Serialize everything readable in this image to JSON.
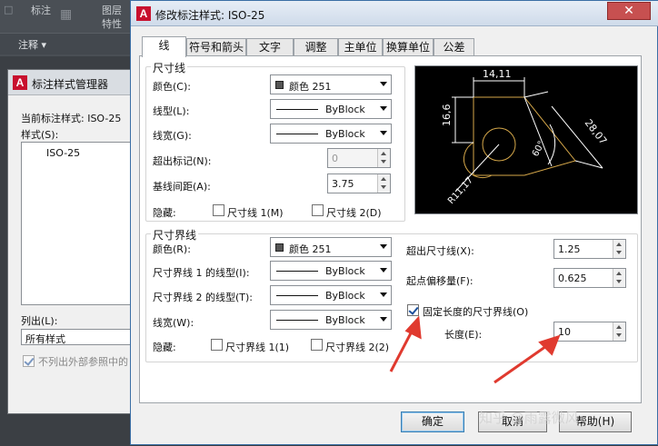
{
  "ribbon": {
    "tab_mark": "标注",
    "layer_label": "图层",
    "props_label": "特性",
    "annotate_label": "注释 ▾"
  },
  "manager": {
    "title": "标注样式管理器",
    "current_style": "当前标注样式: ISO-25",
    "styles_label": "样式(S):",
    "style_item": "ISO-25",
    "list_label": "列出(L):",
    "list_value": "所有样式",
    "xref_checkbox": "不列出外部参照中的"
  },
  "dialog": {
    "title": "修改标注样式: ISO-25",
    "close_symbol": "✕",
    "tabs": [
      "线",
      "符号和箭头",
      "文字",
      "调整",
      "主单位",
      "换算单位",
      "公差"
    ],
    "active_tab": 0,
    "dimline": {
      "group_title": "尺寸线",
      "color_label": "颜色(C):",
      "color_value": "颜色 251",
      "linetype_label": "线型(L):",
      "linetype_value": "ByBlock",
      "lineweight_label": "线宽(G):",
      "lineweight_value": "ByBlock",
      "extend_label": "超出标记(N):",
      "extend_value": "0",
      "baseline_label": "基线间距(A):",
      "baseline_value": "3.75",
      "suppress_label": "隐藏:",
      "suppress_1": "尺寸线 1(M)",
      "suppress_2": "尺寸线 2(D)"
    },
    "extline": {
      "group_title": "尺寸界线",
      "color_label": "颜色(R):",
      "color_value": "颜色 251",
      "linetype1_label": "尺寸界线 1 的线型(I):",
      "linetype1_value": "ByBlock",
      "linetype2_label": "尺寸界线 2 的线型(T):",
      "linetype2_value": "ByBlock",
      "lineweight_label": "线宽(W):",
      "lineweight_value": "ByBlock",
      "suppress_label": "隐藏:",
      "suppress_1": "尺寸界线 1(1)",
      "suppress_2": "尺寸界线 2(2)",
      "beyond_label": "超出尺寸线(X):",
      "beyond_value": "1.25",
      "offset_label": "起点偏移量(F):",
      "offset_value": "0.625",
      "fixed_label": "固定长度的尺寸界线(O)",
      "fixed_checked": true,
      "length_label": "长度(E):",
      "length_value": "10"
    },
    "preview": {
      "dim_top": "14,11",
      "dim_left": "16,6",
      "dim_right": "28,07",
      "dim_angle": "60°",
      "dim_radius": "R11,17"
    },
    "buttons": {
      "ok": "确定",
      "cancel": "取消",
      "help": "帮助(H)"
    }
  },
  "watermark": "知乎 @雨露微风"
}
